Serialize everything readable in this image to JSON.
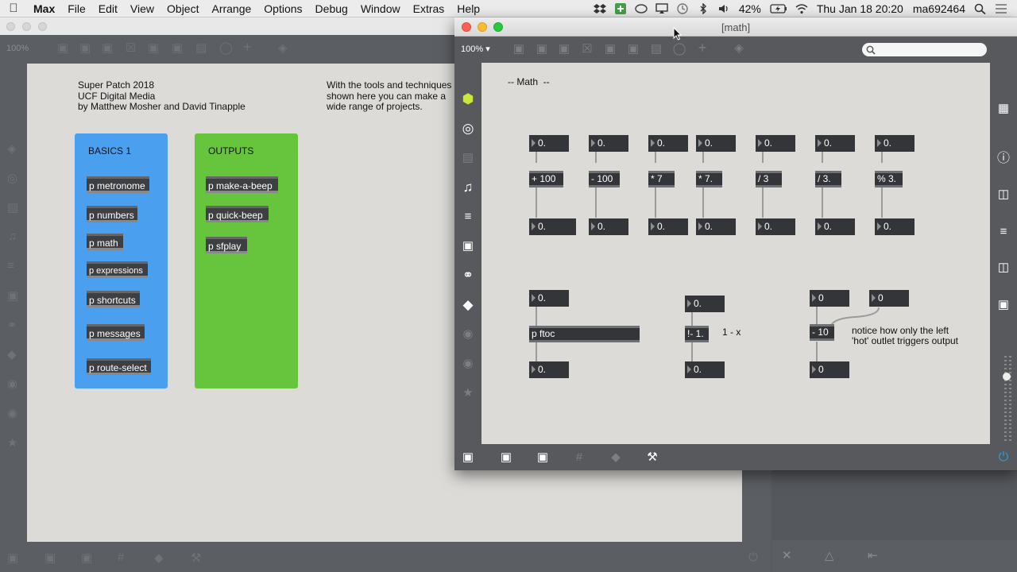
{
  "menubar": {
    "app": "Max",
    "menus": [
      "File",
      "Edit",
      "View",
      "Object",
      "Arrange",
      "Options",
      "Debug",
      "Window",
      "Extras",
      "Help"
    ],
    "battery": "42%",
    "clock": "Thu Jan 18  20:20",
    "user": "ma692464"
  },
  "bg_window": {
    "zoom": "100%",
    "header_left": "Super Patch 2018\nUCF Digital Media\nby Matthew Mosher and David Tinapple",
    "header_right": "With the tools and techniques\nshown here you can make a\nwide range of projects.",
    "basics": {
      "title": "BASICS 1",
      "color": "#4a9fef",
      "items": [
        "p metronome",
        "p numbers",
        "p math",
        "p expressions",
        "p shortcuts",
        "p messages",
        "p route-select"
      ]
    },
    "outputs": {
      "title": "OUTPUTS",
      "color": "#66c43d",
      "items": [
        "p make-a-beep",
        "p quick-beep",
        "p sfplay"
      ]
    }
  },
  "math_window": {
    "title": "[math]",
    "zoom": "100%",
    "search_placeholder": "",
    "comment_title": "-- Math  --",
    "ops": [
      {
        "in": "0.",
        "op": "+ 100",
        "out": "0."
      },
      {
        "in": "0.",
        "op": "- 100",
        "out": "0."
      },
      {
        "in": "0.",
        "op": "* 7",
        "out": "0."
      },
      {
        "in": "0.",
        "op": "* 7.",
        "out": "0."
      },
      {
        "in": "0.",
        "op": "/ 3",
        "out": "0."
      },
      {
        "in": "0.",
        "op": "/ 3.",
        "out": "0."
      },
      {
        "in": "0.",
        "op": "% 3.",
        "out": "0."
      }
    ],
    "ftoc": {
      "in": "0.",
      "op": "p ftoc",
      "out": "0."
    },
    "rminus": {
      "in": "0.",
      "op": "!- 1.",
      "out": "0.",
      "comment": "1 - x"
    },
    "minus10": {
      "in_left": "0",
      "in_right": "0",
      "op": "- 10",
      "out": "0",
      "comment": "notice how only the left\n'hot' outlet triggers output"
    }
  },
  "icons": {
    "apple": "apple-icon",
    "dropbox": "dropbox-icon",
    "bluetooth": "bluetooth-icon",
    "volume": "volume-icon",
    "wifi": "wifi-icon",
    "search": "search-icon",
    "list": "notification-list-icon"
  }
}
